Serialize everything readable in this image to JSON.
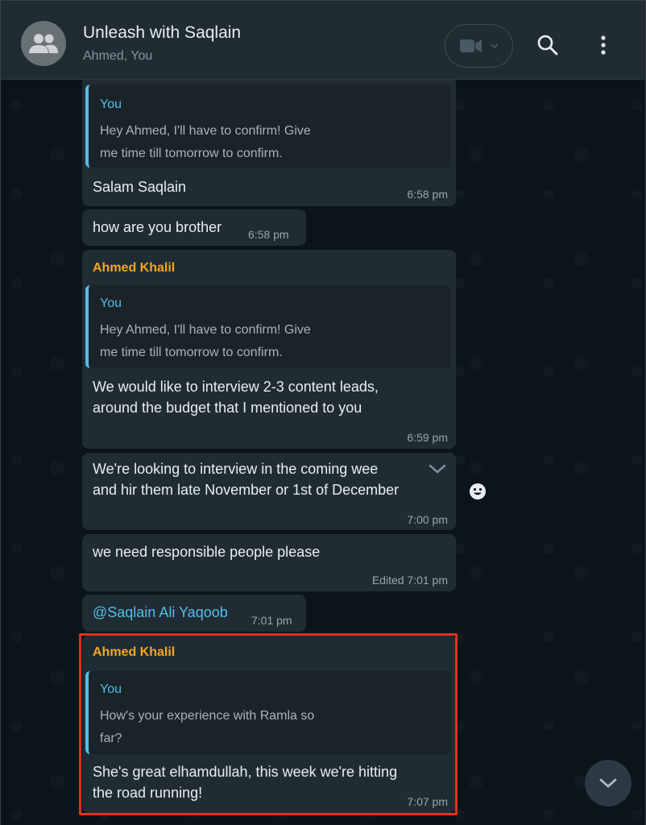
{
  "header": {
    "title": "Unleash with Saqlain",
    "subtitle": "Ahmed, You"
  },
  "messages": [
    {
      "quote_name": "You",
      "quote_line1": "Hey Ahmed, I'll have to confirm! Give",
      "quote_line2": "me time till tomorrow to confirm.",
      "text": "Salam Saqlain",
      "time": "6:58 pm"
    },
    {
      "text": "how are you brother",
      "time": "6:58 pm"
    },
    {
      "sender": "Ahmed Khalil",
      "quote_name": "You",
      "quote_line1": "Hey Ahmed, I'll have to confirm! Give",
      "quote_line2": "me time till tomorrow to confirm.",
      "text_line1": "We would like to interview 2-3 content leads,",
      "text_line2": "around the budget that I mentioned to you",
      "time": "6:59 pm"
    },
    {
      "text_line1": "We're looking to interview in the coming wee",
      "text_line2": "and hir them late November or 1st of December",
      "time": "7:00 pm"
    },
    {
      "text": "we need responsible people please",
      "time": "Edited 7:01 pm"
    },
    {
      "text": "@Saqlain Ali Yaqoob",
      "time": "7:01 pm"
    },
    {
      "sender": "Ahmed Khalil",
      "quote_name": "You",
      "quote_line1": "How's your experience with Ramla so",
      "quote_line2": "far?",
      "text_line1": "She's great elhamdullah, this week we're hitting",
      "text_line2": "the road running!",
      "time": "7:07 pm"
    }
  ],
  "icons": {
    "avatar": "group-icon",
    "video": "video-call-icon",
    "search": "search-icon",
    "menu": "more-vertical-icon",
    "emoji": "emoji-icon",
    "scroll": "chevron-down-icon"
  },
  "colors": {
    "accent_blue": "#53bdeb",
    "sender_orange": "#f5a623",
    "highlight_red": "#e0311f"
  }
}
